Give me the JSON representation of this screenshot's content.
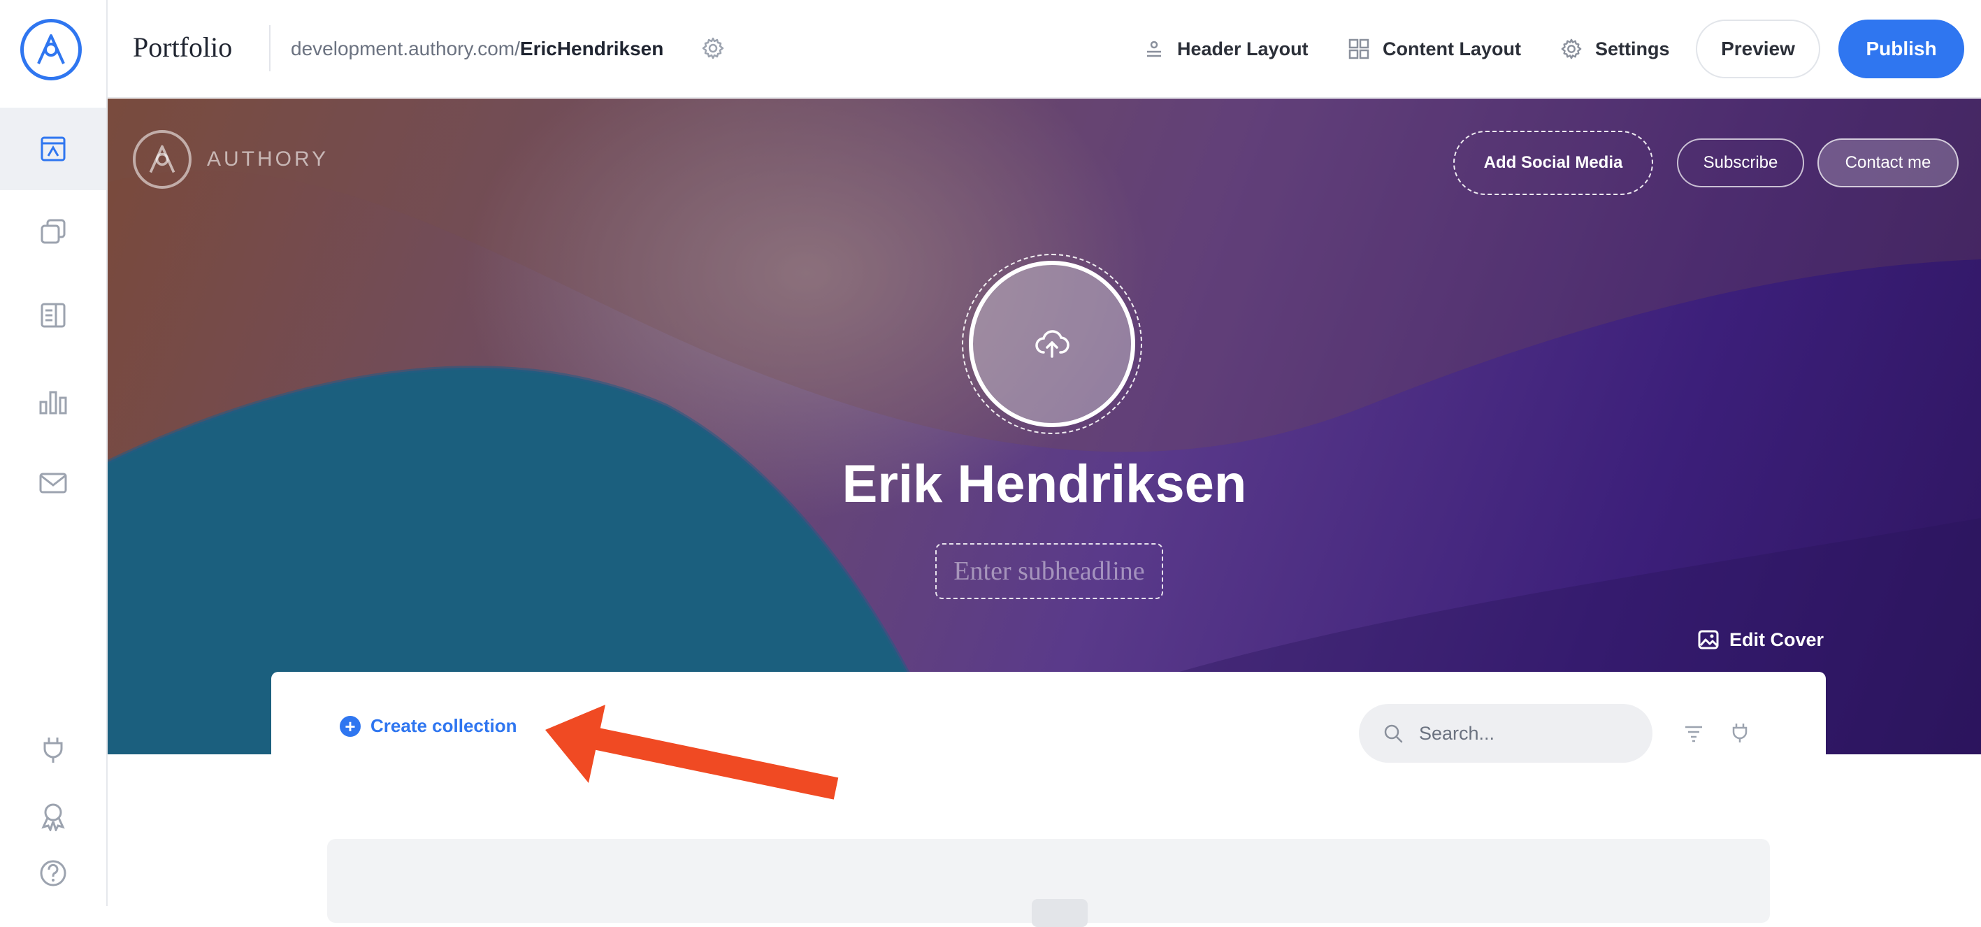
{
  "sidebar": {
    "items": [
      {
        "name": "portfolio",
        "icon": "layout-icon",
        "active": true
      },
      {
        "name": "collections",
        "icon": "copy-icon",
        "active": false
      },
      {
        "name": "articles",
        "icon": "article-icon",
        "active": false
      },
      {
        "name": "analytics",
        "icon": "bar-chart-icon",
        "active": false
      },
      {
        "name": "newsletter",
        "icon": "mail-icon",
        "active": false
      }
    ],
    "bottom_items": [
      {
        "name": "integrations",
        "icon": "plug-icon"
      },
      {
        "name": "achievements",
        "icon": "badge-icon"
      },
      {
        "name": "help",
        "icon": "help-icon"
      }
    ]
  },
  "topbar": {
    "title": "Portfolio",
    "url_prefix": "development.authory.com/",
    "url_user": "EricHendriksen",
    "header_layout": "Header Layout",
    "content_layout": "Content Layout",
    "settings": "Settings",
    "preview": "Preview",
    "publish": "Publish"
  },
  "cover": {
    "brand": "AUTHORY",
    "add_social": "Add Social Media",
    "subscribe": "Subscribe",
    "contact": "Contact me",
    "name": "Erik Hendriksen",
    "subheadline_placeholder": "Enter subheadline",
    "edit_cover": "Edit Cover"
  },
  "content": {
    "create_collection": "Create collection",
    "search_placeholder": "Search..."
  },
  "colors": {
    "accent": "#2f76f0",
    "annotation_arrow": "#f04a23"
  }
}
